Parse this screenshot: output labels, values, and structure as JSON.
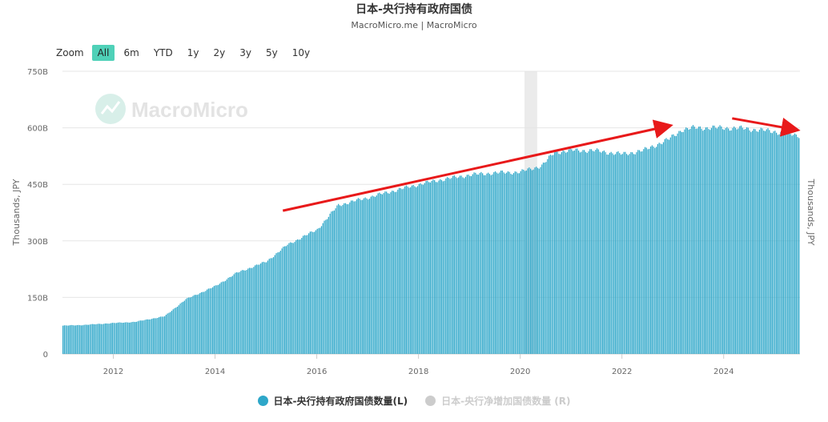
{
  "header": {
    "title": "日本-央行持有政府国债",
    "subtitle": "MacroMicro.me | MacroMicro"
  },
  "range_selector": {
    "label": "Zoom",
    "options": [
      "All",
      "6m",
      "YTD",
      "1y",
      "2y",
      "3y",
      "5y",
      "10y"
    ],
    "selected": "All"
  },
  "watermark": {
    "text": "MacroMicro"
  },
  "colors": {
    "bar": "#2ea7c9",
    "accent_button": "#4fd1b8",
    "arrow": "#e8191a",
    "recession_band": "#ebebeb",
    "legend_off": "#cccccc"
  },
  "chart_data": {
    "type": "bar",
    "title": "日本-央行持有政府国债",
    "subtitle": "MacroMicro.me | MacroMicro",
    "ylabel_left": "Thousands, JPY",
    "ylabel_right": "Thousands, JPY",
    "xlabel": "",
    "y_ticks": [
      "0",
      "150B",
      "300B",
      "450B",
      "600B",
      "750B"
    ],
    "ylim": [
      0,
      750
    ],
    "y_unit": "B JPY",
    "x_ticks": [
      "2012",
      "2014",
      "2016",
      "2018",
      "2020",
      "2022",
      "2024"
    ],
    "xlim": [
      "2011-01",
      "2025-06"
    ],
    "grid": true,
    "legend_position": "bottom-center",
    "shaded_period": {
      "from": "2020-02",
      "to": "2020-05"
    },
    "series": [
      {
        "name": "日本-央行持有政府国债数量(L)",
        "axis": "left",
        "visible": true,
        "frequency": "10-day",
        "anchors": [
          [
            "2011-01",
            75
          ],
          [
            "2011-06",
            77
          ],
          [
            "2012-01",
            82
          ],
          [
            "2012-06",
            85
          ],
          [
            "2013-01",
            100
          ],
          [
            "2013-06",
            145
          ],
          [
            "2014-01",
            180
          ],
          [
            "2014-06",
            215
          ],
          [
            "2015-01",
            245
          ],
          [
            "2015-06",
            290
          ],
          [
            "2016-01",
            330
          ],
          [
            "2016-06",
            395
          ],
          [
            "2017-01",
            415
          ],
          [
            "2017-06",
            430
          ],
          [
            "2018-01",
            450
          ],
          [
            "2018-06",
            462
          ],
          [
            "2019-01",
            475
          ],
          [
            "2019-06",
            480
          ],
          [
            "2020-01",
            483
          ],
          [
            "2020-06",
            500
          ],
          [
            "2020-09",
            535
          ],
          [
            "2021-01",
            540
          ],
          [
            "2021-06",
            540
          ],
          [
            "2022-01",
            530
          ],
          [
            "2022-06",
            540
          ],
          [
            "2022-12",
            570
          ],
          [
            "2023-03",
            595
          ],
          [
            "2023-06",
            600
          ],
          [
            "2024-01",
            600
          ],
          [
            "2024-06",
            598
          ],
          [
            "2025-01",
            590
          ],
          [
            "2025-06",
            580
          ]
        ]
      },
      {
        "name": "日本-央行净增加国债数量 (R)",
        "axis": "right",
        "visible": false
      }
    ],
    "annotations": [
      {
        "type": "arrow",
        "color": "red",
        "from": [
          "2015-05",
          380
        ],
        "to": [
          "2022-12",
          605
        ]
      },
      {
        "type": "arrow",
        "color": "red",
        "from": [
          "2024-03",
          625
        ],
        "to": [
          "2025-06",
          595
        ]
      }
    ]
  }
}
